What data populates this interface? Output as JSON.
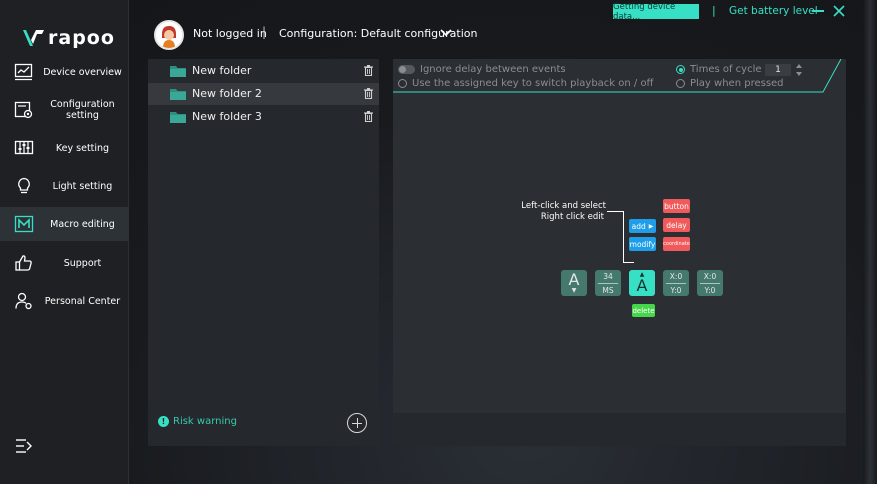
{
  "app": {
    "brand": "rapoo"
  },
  "header": {
    "user_status": "Not logged in",
    "separator": "|",
    "config_label": "Configuration: Default configuration"
  },
  "topbar": {
    "status_badge": "Getting device data...",
    "separator": "|",
    "battery_link": "Get battery level"
  },
  "sidebar": {
    "items": [
      {
        "label": "Device overview",
        "icon": "chart-monitor-icon"
      },
      {
        "label": "Configuration setting",
        "icon": "config-gear-icon"
      },
      {
        "label": "Key setting",
        "icon": "sliders-icon"
      },
      {
        "label": "Light setting",
        "icon": "lightbulb-icon"
      },
      {
        "label": "Macro editing",
        "icon": "macro-icon",
        "active": true
      },
      {
        "label": "Support",
        "icon": "thumbs-up-icon"
      },
      {
        "label": "Personal Center",
        "icon": "user-gear-icon"
      }
    ]
  },
  "folders": {
    "items": [
      {
        "name": "New folder",
        "selected": false
      },
      {
        "name": "New folder 2",
        "selected": true
      },
      {
        "name": "New folder 3",
        "selected": false
      }
    ],
    "risk_icon": "!",
    "risk_warning": "Risk warning"
  },
  "options": {
    "ignore_delay": "Ignore delay between events",
    "use_assigned_key": "Use the assigned key to switch playback on / off",
    "times_of_cycle": "Times of cycle",
    "cycle_value": "1",
    "play_when_pressed": "Play when pressed"
  },
  "macro": {
    "hint_line1": "Left-click and select",
    "hint_line2": "Right click edit",
    "menu": {
      "add": "add",
      "modify": "modify",
      "button": "button",
      "delay": "delay",
      "coordinate": "coordinate",
      "delete": "delete"
    },
    "events": [
      {
        "type": "key",
        "letter": "A",
        "direction": "down"
      },
      {
        "type": "delay",
        "value": "34",
        "unit": "MS"
      },
      {
        "type": "key",
        "letter": "A",
        "direction": "up",
        "selected": true
      },
      {
        "type": "coord",
        "x": "X:0",
        "y": "Y:0"
      },
      {
        "type": "coord",
        "x": "X:0",
        "y": "Y:0"
      }
    ]
  },
  "colors": {
    "accent": "#37e0c4",
    "tile": "#45796e",
    "red_chip": "#f05a5a",
    "blue_chip": "#1e9de8",
    "green_chip": "#46d64a"
  }
}
